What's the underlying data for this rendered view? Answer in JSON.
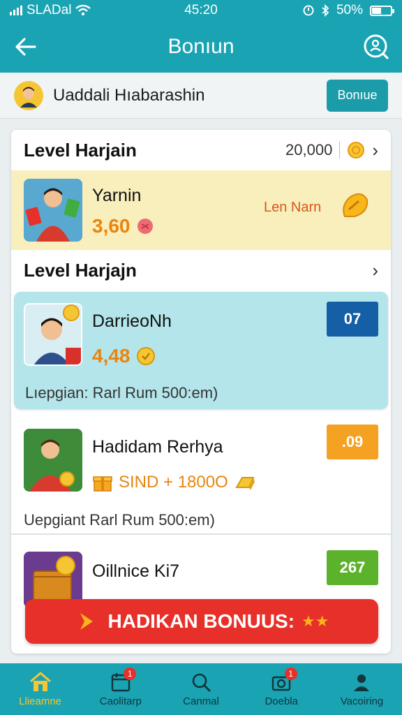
{
  "status_bar": {
    "carrier": "SLADal",
    "time": "45:20",
    "battery": "50%",
    "battery_level": 0.5
  },
  "app_bar": {
    "title": "Bonıun"
  },
  "user": {
    "name": "Uaddali Hıabarashin",
    "button": "Bonıue"
  },
  "levels": [
    {
      "title": "Level Harjain",
      "points": "20,000"
    },
    {
      "title": "Level Harjajn"
    }
  ],
  "items": [
    {
      "name": "Yarnin",
      "value": "3,60",
      "side_label": "Len Narn"
    },
    {
      "name": "DarrieoNh",
      "value": "4,48",
      "badge": "07",
      "subtext": "Lıepgian: Rarl Rum 500:em)"
    },
    {
      "name": "Hadidam Rerhya",
      "value": "SIND + 1800O",
      "badge": ".09",
      "subtext": "Uepgiant Rarl Rum 500:em)"
    },
    {
      "name": "Oillnice Ki7",
      "badge": "267"
    }
  ],
  "cta": {
    "label": "HADIKAN BONUUS:"
  },
  "nav": [
    {
      "label": "Llieamne"
    },
    {
      "label": "Caolitarp",
      "badge": "1"
    },
    {
      "label": "Canmal"
    },
    {
      "label": "Doebla",
      "badge": "1"
    },
    {
      "label": "Vacoiring"
    }
  ],
  "colors": {
    "teal": "#1aa3b3",
    "highlight_yellow": "#f8efbc",
    "highlight_blue": "#b4e5ea",
    "badge_blue": "#155fa6",
    "badge_orange": "#f5a122",
    "badge_green": "#5db22c",
    "cta_red": "#e7302a"
  }
}
